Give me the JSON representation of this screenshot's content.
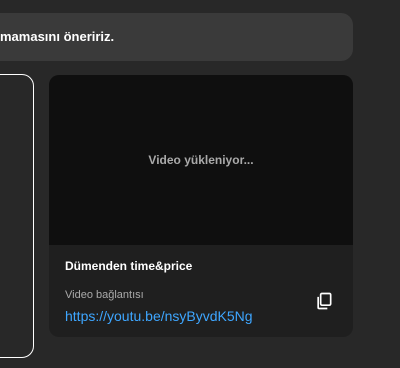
{
  "notice": {
    "text": "mamasını öneririz."
  },
  "video_card": {
    "loading_text": "Video yükleniyor...",
    "title": "Dümenden time&price",
    "link_label": "Video bağlantısı",
    "link_url": "https://youtu.be/nsyByvdK5Ng",
    "copy_icon": "copy-icon"
  },
  "colors": {
    "background": "#282828",
    "card": "#1f1f1f",
    "video_bg": "#0f0f0f",
    "link": "#3ea6ff"
  }
}
